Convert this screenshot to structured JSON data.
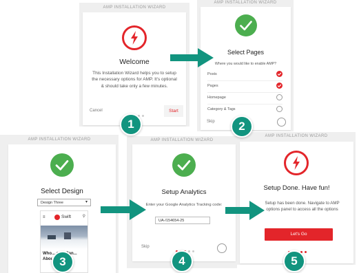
{
  "colors": {
    "accent_red": "#e3252a",
    "success_green": "#4cae4f",
    "badge_teal": "#12947f",
    "frame_gray": "#efefef"
  },
  "screens": {
    "welcome": {
      "header": "AMP INSTALLATION WIZARD",
      "icon": "lightning-bolt-icon",
      "title": "Welcome",
      "description": "This Installation Wizard helps you to setup the necessary options for AMP. It's optional & should take only a few minutes.",
      "cancel_label": "Cancel",
      "start_label": "Start",
      "step_badge": "1"
    },
    "select_pages": {
      "header": "AMP INSTALLATION WIZARD",
      "icon": "checkmark-icon",
      "title": "Select Pages",
      "prompt": "Where you would like to enable AMP?",
      "options": [
        {
          "label": "Posts",
          "checked": true
        },
        {
          "label": "Pages",
          "checked": true
        },
        {
          "label": "Homepage",
          "checked": false
        },
        {
          "label": "Category & Tags",
          "checked": false
        }
      ],
      "skip_label": "Skip",
      "step_badge": "2"
    },
    "select_design": {
      "header": "AMP INSTALLATION WIZARD",
      "icon": "checkmark-icon",
      "title": "Select Design",
      "design_select_value": "Design Three",
      "preview_brand": "Swift",
      "preview_headline": "Who... ame Can... About Reviews",
      "step_badge": "3"
    },
    "setup_analytics": {
      "header": "AMP INSTALLATION WIZARD",
      "icon": "checkmark-icon",
      "title": "Setup Analytics",
      "prompt": "Enter your Google Analytics Tracking code:",
      "tracking_code_value": "UA-/154654-25",
      "skip_label": "Skip",
      "step_badge": "4"
    },
    "setup_done": {
      "header": "AMP INSTALLATION WIZARD",
      "icon": "lightning-bolt-icon",
      "title": "Setup Done. Have fun!",
      "description": "Setup has been done. Navigate to AMP options panel to access all the options",
      "button_label": "Let's Go",
      "step_badge": "5"
    }
  }
}
